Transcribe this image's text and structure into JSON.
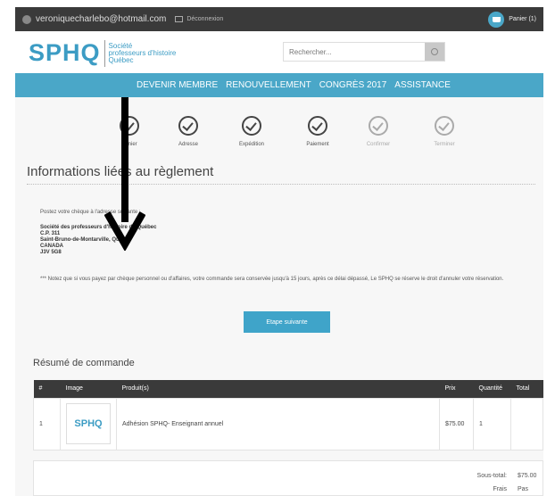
{
  "topbar": {
    "email": "veroniquecharlebo@hotmail.com",
    "logout": "Déconnexion",
    "cart": "Panier (1)"
  },
  "header": {
    "logo_big": "SPHQ",
    "logo_line1": "Société",
    "logo_line2": "professeurs d'histoire",
    "logo_line3": "Québec",
    "search_placeholder": "Rechercher..."
  },
  "nav": [
    "DEVENIR MEMBRE",
    "RENOUVELLEMENT",
    "CONGRÈS 2017",
    "ASSISTANCE"
  ],
  "steps": [
    {
      "label": "Panier",
      "done": true
    },
    {
      "label": "Adresse",
      "done": true
    },
    {
      "label": "Expédition",
      "done": true
    },
    {
      "label": "Paiement",
      "done": true
    },
    {
      "label": "Confirmer",
      "done": false
    },
    {
      "label": "Terminer",
      "done": false
    }
  ],
  "section_title": "Informations liées au règlement",
  "instruction": "Postez votre chèque à l'adresse suivante :",
  "address": {
    "line1": "Société des professeurs d'histoire du Québec",
    "line2": "C.P. 311",
    "line3": "Saint-Bruno-de-Montarville, Québec",
    "line4": "CANADA",
    "line5": "J3V 5G8"
  },
  "notice": "*** Notez que si vous payez par chèque personnel ou d'affaires, votre commande sera conservée jusqu'à 15 jours, après ce délai dépassé, Le SPHQ se réserve le droit d'annuler votre réservation.",
  "next_button": "Etape suivante",
  "summary": {
    "title": "Résumé de commande",
    "headers": [
      "#",
      "Image",
      "Produit(s)",
      "Prix",
      "Quantité",
      "Total"
    ],
    "rows": [
      {
        "num": "1",
        "logo": "SPHQ",
        "product": "Adhésion SPHQ- Enseignant annuel",
        "price": "$75.00",
        "qty": "1",
        "total": ""
      }
    ],
    "subtotal_label": "Sous-total:",
    "subtotal_value": "$75.00",
    "fees_label": "Frais",
    "fees_value": "Pas"
  },
  "colors": {
    "accent": "#4aa7c8",
    "topbar": "#3a3a3a"
  }
}
